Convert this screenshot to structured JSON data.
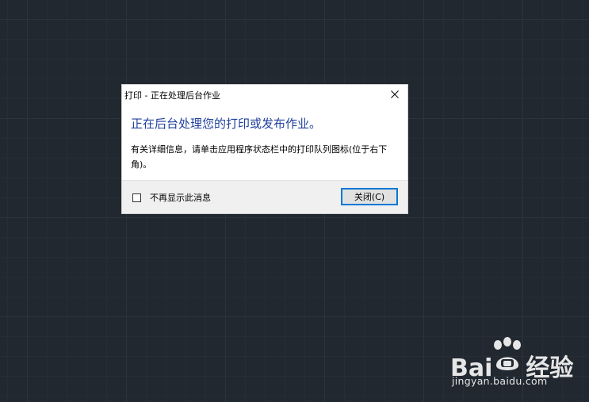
{
  "dialog": {
    "title": "打印 - 正在处理后台作业",
    "heading": "正在后台处理您的打印或发布作业。",
    "message": "有关详细信息，请单击应用程序状态栏中的打印队列图标(位于右下角)。",
    "checkbox_label": "不再显示此消息",
    "checkbox_checked": false,
    "close_button_label": "关闭(C)",
    "close_icon": "close-icon"
  },
  "watermark": {
    "brand_left": "Bai",
    "brand_right": "经验",
    "url": "jingyan.baidu.com"
  },
  "colors": {
    "canvas_background": "#212830",
    "heading_blue": "#1f3f9c",
    "button_focus_border": "#0078d7"
  }
}
